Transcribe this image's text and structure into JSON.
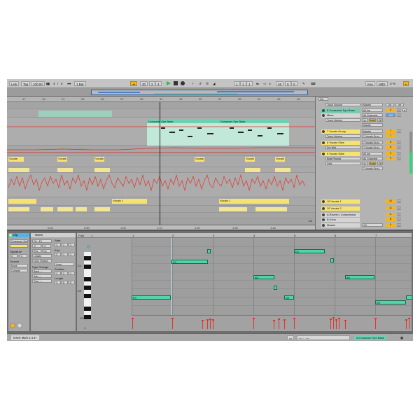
{
  "topbar": {
    "link": "Link",
    "tap": "Tap",
    "tempo": "100.00",
    "sig_num": "4",
    "sig_slash": "/",
    "sig_den": "4",
    "quant": "1 Bar",
    "pos_bar": "30",
    "pos_beat": "2",
    "pos_sixteenth": "4",
    "loop_bar": "1",
    "loop_beat": "1",
    "loop_sixteenth": "1",
    "len_bar": "48",
    "len_beat": "0",
    "len_sixteenth": "0",
    "key": "Key",
    "midi": "MIDI",
    "cpu": "3 %"
  },
  "arrangement": {
    "ruler_ticks": [
      "17",
      "19",
      "21",
      "23",
      "25",
      "27",
      "29",
      "31",
      "33",
      "35",
      "37",
      "39",
      "41",
      "43",
      "45"
    ],
    "time_ticks": [
      "0:40",
      "0:50",
      "1:00",
      "1:10",
      "1:20",
      "1:30",
      "1:40"
    ],
    "clips": [
      {
        "label": "Crossover Syn Base",
        "lane": 1
      },
      {
        "label": "Crossover Syn Base",
        "lane": 1
      },
      {
        "label": "Vocals",
        "lane": 2
      },
      {
        "label": "Vocals",
        "lane": 2
      },
      {
        "label": "Vocals",
        "lane": 2
      },
      {
        "label": "Vocals",
        "lane": 2
      },
      {
        "label": "Vocals",
        "lane": 2
      },
      {
        "label": "Vocals",
        "lane": 2
      },
      {
        "label": "Vocals 1",
        "lane": 4
      },
      {
        "label": "Vocals 1",
        "lane": 4
      }
    ],
    "zoom_label": "1/2"
  },
  "mixer": {
    "set_label": "Set",
    "rows": [
      {
        "name": "Track Volume",
        "kind": "sel-only",
        "io": "Master",
        "vol": "inf",
        "pan": "inf"
      },
      {
        "name": "5 Crossover Syn Base",
        "kind": "teal",
        "io": "All Ins",
        "num": "5",
        "s": "S"
      },
      {
        "name": "Mixer",
        "kind": "gray",
        "io": "All Channels",
        "vol": "-6.0",
        "s": "S"
      },
      {
        "name": "Track Volume",
        "kind": "sel-only",
        "io": "In",
        "auto": "Auto",
        "off": "Off"
      },
      {
        "name": "",
        "kind": "sel-only",
        "io": "Master"
      },
      {
        "name": "7 Vocals Group",
        "kind": "yellow",
        "io": "Master",
        "num": "7",
        "s": "S"
      },
      {
        "name": "Track Volume",
        "kind": "sel-only",
        "io": "7 Vocals Grou",
        "num": "7"
      },
      {
        "name": "8 Vocals Slice",
        "kind": "yellow",
        "io": "7 Vocals Grou",
        "num": "8",
        "s": "S"
      },
      {
        "name": "Dry Wet",
        "kind": "sel-only",
        "io": "7 Vocals Grou",
        "num": "8",
        "s": "S"
      },
      {
        "name": "9 Vocals Slice",
        "kind": "yellow",
        "io": "All Ins",
        "num": "9",
        "s": "S"
      },
      {
        "name": "Beat Repeat",
        "kind": "sel-only",
        "io": "All Channels",
        "num": "9",
        "s": "S"
      },
      {
        "name": "Grid",
        "kind": "sel-only",
        "io": "In",
        "auto": "Auto",
        "off": "Off"
      },
      {
        "name": "",
        "kind": "sel-only",
        "io": "7 Vocals Grou"
      },
      {
        "name": "10 Vocals 1",
        "kind": "yellow",
        "io": "",
        "num": "10",
        "s": "S"
      },
      {
        "name": "10 Vocals 2",
        "kind": "yellow",
        "io": "",
        "num": "11",
        "s": "S"
      },
      {
        "name": "A Reverb | Compressor",
        "kind": "gray",
        "io": "",
        "num": "A",
        "s": "S"
      },
      {
        "name": "B Echo",
        "kind": "gray",
        "io": "",
        "num": "B",
        "s": "S"
      },
      {
        "name": "Master",
        "kind": "gray",
        "io": "1/2",
        "num": "0",
        "s": "S"
      }
    ]
  },
  "clip_panel": {
    "title": "Clip",
    "name_value": "Crossover Syn",
    "signature_label": "Signature",
    "sig_num": "4",
    "sig_den": "4",
    "groove_label": "Groove",
    "groove_value": "None",
    "commit_label": "Commit"
  },
  "notes_panel": {
    "title": "Notes",
    "key_value": "D0 - E1",
    "start_label": "Start",
    "start_bar": "1",
    "start_beat": "1",
    "start_sixteenth": "1",
    "end_label": "End",
    "end_bar": "3",
    "end_beat": "1",
    "end_sixteenth": "1",
    "legato": "Legato",
    "dupl_loop": "Dupl. Region",
    "loop_label": "Loop",
    "position_label": "Position",
    "pgm_change_label": "Pgm Change",
    "length_label": "Length",
    "bank": "Bank ---",
    "sub": "Sub ---",
    "pgm": "Pgm ---"
  },
  "piano_roll": {
    "fold": "Fold",
    "bars": [
      "1",
      "2",
      "3",
      "4",
      "5",
      "6",
      "7",
      "8"
    ],
    "key_labels": [
      "C1",
      "C0"
    ],
    "vel_label": "127",
    "vel_min": "1",
    "notes": [
      "F0",
      "C1",
      "D1",
      "A0",
      "A0",
      "G0",
      "E0"
    ]
  },
  "statusbar": {
    "message": "Insert Mark 2.4.4+",
    "track": "5-Crossover Syn Base"
  },
  "colors": {
    "accent_orange": "#f3b422",
    "clip_teal": "#6cd1b2",
    "clip_yellow": "#f6e36e",
    "automation_red": "#e0342b",
    "play_green": "#2bbd52",
    "selection_blue": "#4fb5e8"
  }
}
